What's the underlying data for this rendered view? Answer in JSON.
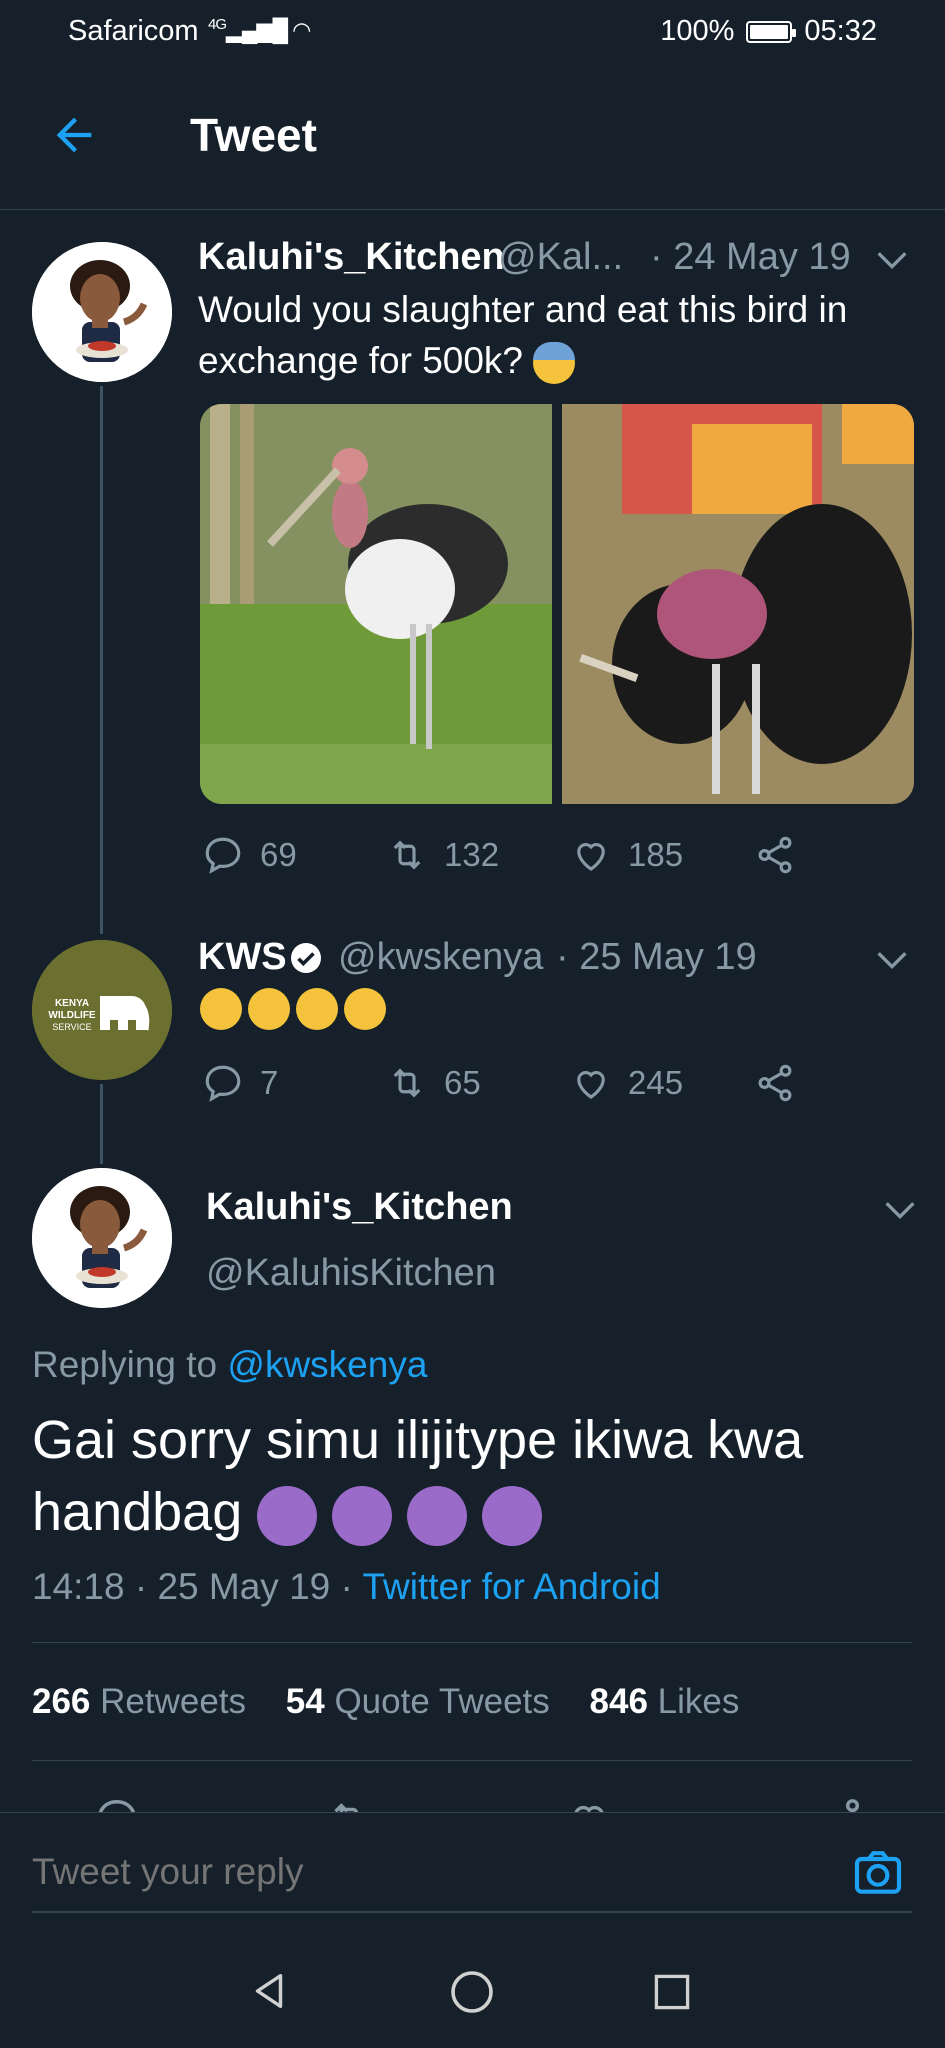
{
  "status_bar": {
    "carrier": "Safaricom",
    "network": "4G",
    "battery": "100%",
    "time": "05:32"
  },
  "header": {
    "title": "Tweet"
  },
  "tweet1": {
    "name": "Kaluhi's_Kitchen",
    "handle": "@Kal...",
    "date": "· 24 May 19",
    "text": "Would you slaughter and eat this bird in exchange for 500k?",
    "replies": "69",
    "retweets": "132",
    "likes": "185"
  },
  "tweet2": {
    "name": "KWS",
    "handle": "@kwskenya",
    "date": "· 25 May 19",
    "replies": "7",
    "retweets": "65",
    "likes": "245",
    "avatar_text": [
      "KENYA",
      "WILDLIFE",
      "SERVICE"
    ]
  },
  "main_tweet": {
    "name": "Kaluhi's_Kitchen",
    "handle": "@KaluhisKitchen",
    "replying_prefix": "Replying to",
    "replying_handle": "@kwskenya",
    "text": "Gai sorry simu ilijitype ikiwa kwa handbag",
    "time_date": "14:18 · 25 May 19 ·",
    "source": "Twitter for Android",
    "retweets_count": "266",
    "retweets_label": "Retweets",
    "quotes_count": "54",
    "quotes_label": "Quote Tweets",
    "likes_count": "846",
    "likes_label": "Likes"
  },
  "reply_bar": {
    "placeholder": "Tweet your reply"
  },
  "colors": {
    "background": "#15202b",
    "accent": "#1da1f2",
    "muted": "#8899a6",
    "divider": "#38444d"
  }
}
